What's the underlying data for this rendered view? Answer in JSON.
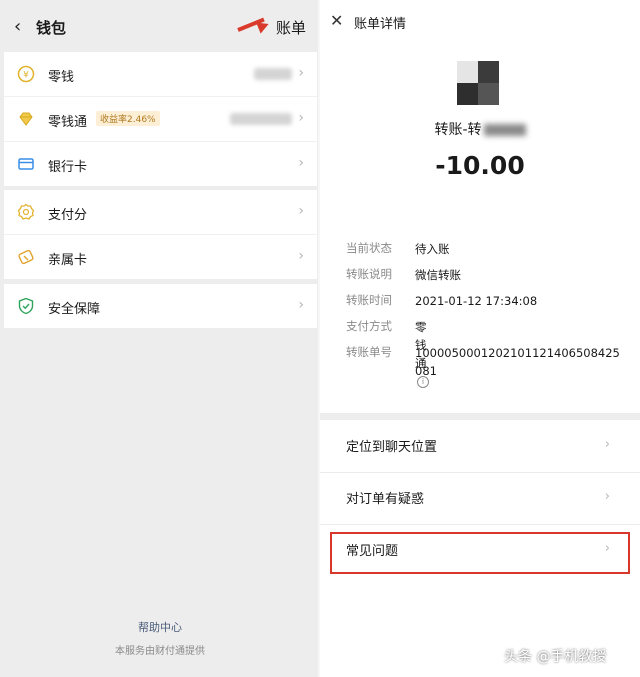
{
  "wallet": {
    "title": "钱包",
    "bill_link": "账单",
    "items": [
      {
        "label": "零钱",
        "icon": "coin-icon"
      },
      {
        "label": "零钱通",
        "badge": "收益率2.46%",
        "icon": "diamond-icon"
      },
      {
        "label": "银行卡",
        "icon": "bank-card-icon"
      },
      {
        "label": "支付分",
        "icon": "pay-score-icon"
      },
      {
        "label": "亲属卡",
        "icon": "family-card-icon"
      },
      {
        "label": "安全保障",
        "icon": "shield-icon"
      }
    ],
    "help_center": "帮助中心",
    "provider": "本服务由财付通提供"
  },
  "bill_detail": {
    "title": "账单详情",
    "payee": "转账-转",
    "amount": "-10.00",
    "fields": [
      {
        "label": "当前状态",
        "value": "待入账"
      },
      {
        "label": "转账说明",
        "value": "微信转账"
      },
      {
        "label": "转账时间",
        "value": "2021-01-12 17:34:08"
      },
      {
        "label": "支付方式",
        "value": "零钱通"
      },
      {
        "label": "转账单号",
        "value": "1000050001202101121406508425081"
      }
    ],
    "menu": [
      "定位到聊天位置",
      "对订单有疑惑",
      "常见问题"
    ]
  },
  "watermark": "头条 @手机教授",
  "colors": {
    "accent_red": "#d93a2b",
    "badge_text": "#b07a1e",
    "shield_green": "#2fa35a",
    "coin_yellow": "#f0c030"
  }
}
